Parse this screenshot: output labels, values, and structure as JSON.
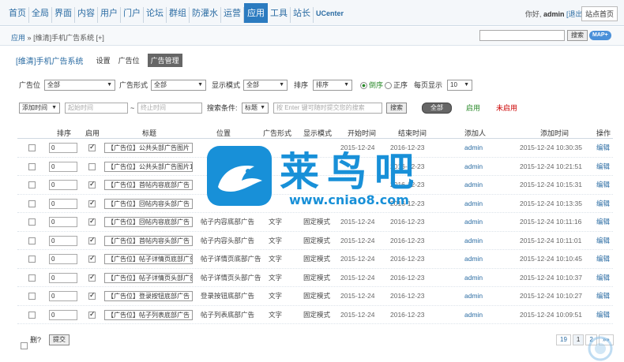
{
  "topnav": {
    "items": [
      "首页",
      "全局",
      "界面",
      "内容",
      "用户",
      "门户",
      "论坛",
      "群组",
      "防灌水",
      "运营",
      "应用",
      "工具",
      "站长",
      "UCenter"
    ],
    "active_index": 10,
    "greeting": "你好,",
    "username": "admin",
    "logout": "[退出]",
    "home_button": "站点首页"
  },
  "crumb": {
    "root": "应用",
    "sep": "»",
    "current": "[维清]手机广告系统",
    "add": "[+]",
    "search_button": "搜索",
    "map_button": "MAP"
  },
  "title": {
    "plugin": "[维清]手机广告系统",
    "tabs": [
      "设置",
      "广告位",
      "广告管理"
    ],
    "active_tab": 2
  },
  "filter": {
    "ad_position_label": "广告位",
    "ad_position_value": "全部",
    "ad_form_label": "广告形式",
    "ad_form_value": "全部",
    "display_style_label": "显示模式",
    "display_style_value": "全部",
    "sort_label": "排序",
    "sort_value": "排序",
    "order_desc": "倒序",
    "order_asc": "正序",
    "per_page_label": "每页显示",
    "per_page_value": "10",
    "time_type": "添加时间",
    "start_placeholder": "起始时间",
    "tilde": "~",
    "end_placeholder": "终止时间",
    "search_cond_label": "搜索条件:",
    "search_cond_value": "标题",
    "keyword_placeholder": "按 Enter 键可随时提交您的搜索",
    "search_button": "搜索",
    "all_button": "全部",
    "enabled_link": "启用",
    "disabled_link": "未启用"
  },
  "table": {
    "headers": [
      "排序",
      "启用",
      "标题",
      "位置",
      "广告形式",
      "显示模式",
      "开始时间",
      "结束时间",
      "添加人",
      "添加时间",
      "操作"
    ],
    "rows": [
      {
        "order": "0",
        "enabled": true,
        "title": "【广告位】公共头部广告图片",
        "position": "",
        "form": "",
        "mode": "",
        "start": "2015-12-24",
        "end": "2016-12-23",
        "user": "admin",
        "time": "2015-12-24 10:30:35",
        "op": "编辑"
      },
      {
        "order": "0",
        "enabled": false,
        "title": "【广告位】公共头部广告图片1",
        "position": "",
        "form": "",
        "mode": "",
        "start": "",
        "end": "2016-12-23",
        "user": "admin",
        "time": "2015-12-24 10:21:51",
        "op": "编辑"
      },
      {
        "order": "0",
        "enabled": true,
        "title": "【广告位】首帖内容底部广告",
        "position": "",
        "form": "",
        "mode": "",
        "start": "",
        "end": "2016-12-23",
        "user": "admin",
        "time": "2015-12-24 10:15:31",
        "op": "编辑"
      },
      {
        "order": "0",
        "enabled": true,
        "title": "【广告位】回帖内容头部广告",
        "position": "",
        "form": "",
        "mode": "",
        "start": "",
        "end": "2016-12-23",
        "user": "admin",
        "time": "2015-12-24 10:13:35",
        "op": "编辑"
      },
      {
        "order": "0",
        "enabled": true,
        "title": "【广告位】回帖内容底部广告",
        "position": "帖子内容底部广告",
        "form": "文字",
        "mode": "固定模式",
        "start": "2015-12-24",
        "end": "2016-12-23",
        "user": "admin",
        "time": "2015-12-24 10:11:16",
        "op": "编辑"
      },
      {
        "order": "0",
        "enabled": true,
        "title": "【广告位】首帖内容头部广告",
        "position": "帖子内容头部广告",
        "form": "文字",
        "mode": "固定模式",
        "start": "2015-12-24",
        "end": "2016-12-23",
        "user": "admin",
        "time": "2015-12-24 10:11:01",
        "op": "编辑"
      },
      {
        "order": "0",
        "enabled": true,
        "title": "【广告位】帖子详情页底部广告",
        "position": "帖子详情页底部广告",
        "form": "文字",
        "mode": "固定模式",
        "start": "2015-12-24",
        "end": "2016-12-23",
        "user": "admin",
        "time": "2015-12-24 10:10:45",
        "op": "编辑"
      },
      {
        "order": "0",
        "enabled": true,
        "title": "【广告位】帖子详情页头部广告",
        "position": "帖子详情页头部广告",
        "form": "文字",
        "mode": "固定模式",
        "start": "2015-12-24",
        "end": "2016-12-23",
        "user": "admin",
        "time": "2015-12-24 10:10:37",
        "op": "编辑"
      },
      {
        "order": "0",
        "enabled": true,
        "title": "【广告位】登录按钮底部广告",
        "position": "登录按钮底部广告",
        "form": "文字",
        "mode": "固定模式",
        "start": "2015-12-24",
        "end": "2016-12-23",
        "user": "admin",
        "time": "2015-12-24 10:10:27",
        "op": "编辑"
      },
      {
        "order": "0",
        "enabled": true,
        "title": "【广告位】帖子列表底部广告",
        "position": "帖子列表底部广告",
        "form": "文字",
        "mode": "固定模式",
        "start": "2015-12-24",
        "end": "2016-12-23",
        "user": "admin",
        "time": "2015-12-24 10:09:51",
        "op": "编辑"
      }
    ]
  },
  "footer": {
    "delete_label": "删?",
    "submit_button": "提交",
    "pages": [
      "19",
      "1",
      "2",
      "»»"
    ],
    "current_page": 1
  },
  "watermark": {
    "text": "莱鸟吧",
    "url": "www.cniao8.com"
  },
  "colors": {
    "link": "#2b6ca3",
    "active_nav": "#2b7bc0",
    "enabled": "#2a8a2a",
    "disabled": "#cc0000",
    "watermark": "#1890d8"
  }
}
